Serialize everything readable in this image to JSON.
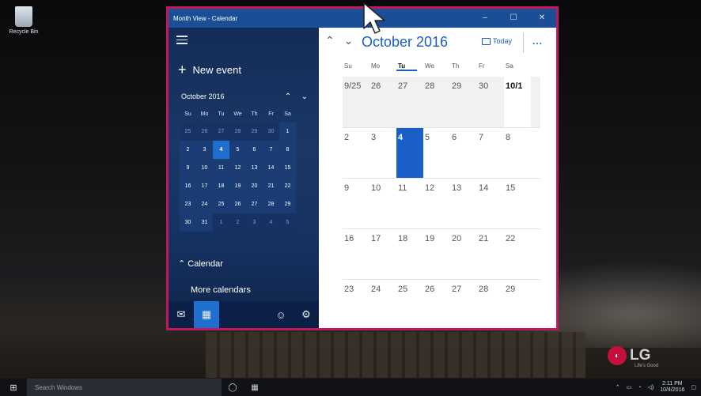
{
  "desktop": {
    "recycle_bin_label": "Recycle Bin",
    "brand_logo": "LG",
    "brand_tagline": "Life's Good"
  },
  "window": {
    "title": "Month View - Calendar",
    "controls": {
      "minimize": "–",
      "maximize": "☐",
      "close": "✕"
    }
  },
  "sidebar": {
    "new_event_label": "New event",
    "mini_calendar": {
      "month_label": "October 2016",
      "weekdays": [
        "Su",
        "Mo",
        "Tu",
        "We",
        "Th",
        "Fr",
        "Sa"
      ],
      "weeks": [
        [
          "25",
          "26",
          "27",
          "28",
          "29",
          "30",
          "1"
        ],
        [
          "2",
          "3",
          "4",
          "5",
          "6",
          "7",
          "8"
        ],
        [
          "9",
          "10",
          "11",
          "12",
          "13",
          "14",
          "15"
        ],
        [
          "16",
          "17",
          "18",
          "19",
          "20",
          "21",
          "22"
        ],
        [
          "23",
          "24",
          "25",
          "26",
          "27",
          "28",
          "29"
        ],
        [
          "30",
          "31",
          "1",
          "2",
          "3",
          "4",
          "5"
        ]
      ],
      "today": "4"
    },
    "calendar_section_label": "Calendar",
    "more_calendars_label": "More calendars",
    "bottom_icons": [
      "mail-icon",
      "calendar-icon",
      "smiley-feedback-icon",
      "settings-gear-icon"
    ]
  },
  "main": {
    "month_title": "October 2016",
    "today_button_label": "Today",
    "more_label": "...",
    "weekdays": [
      "Su",
      "Mo",
      "Tu",
      "We",
      "Th",
      "Fr",
      "Sa"
    ],
    "current_weekday": "Tu",
    "weeks": [
      [
        "9/25",
        "26",
        "27",
        "28",
        "29",
        "30",
        "10/1"
      ],
      [
        "2",
        "3",
        "4",
        "5",
        "6",
        "7",
        "8"
      ],
      [
        "9",
        "10",
        "11",
        "12",
        "13",
        "14",
        "15"
      ],
      [
        "16",
        "17",
        "18",
        "19",
        "20",
        "21",
        "22"
      ],
      [
        "23",
        "24",
        "25",
        "26",
        "27",
        "28",
        "29"
      ]
    ],
    "today": "4"
  },
  "taskbar": {
    "search_placeholder": "Search Windows",
    "time": "2:11 PM",
    "date": "10/4/2016"
  },
  "colors": {
    "accent": "#1b5ec1",
    "today_fill": "#1a5fc8",
    "window_border": "#c2185b",
    "titlebar": "#1a4f95"
  }
}
